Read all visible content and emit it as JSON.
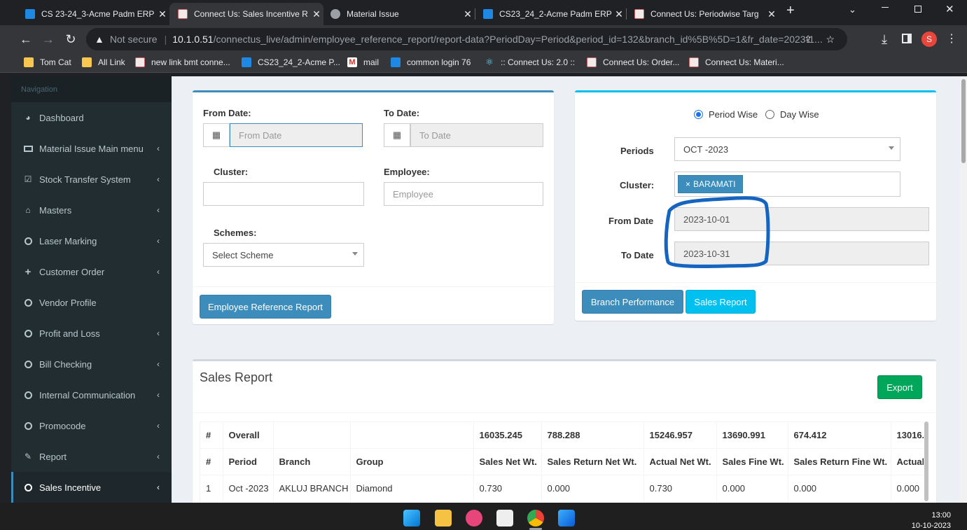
{
  "browser": {
    "tabs": [
      {
        "title": "CS 23-24_3-Acme Padm ERP",
        "close": "✕"
      },
      {
        "title": "Connect Us: Sales Incentive R",
        "close": "✕"
      },
      {
        "title": "Material Issue",
        "close": "✕"
      },
      {
        "title": "CS23_24_2-Acme Padm ERP",
        "close": "✕"
      },
      {
        "title": "Connect Us: Periodwise Targ",
        "close": "✕"
      }
    ],
    "new_tab": "+",
    "security": "Not secure",
    "url_host": "10.1.0.51",
    "url_path": "/connectus_live/admin/employee_reference_report/report-data?PeriodDay=Period&period_id=132&branch_id%5B%5D=1&fr_date=2023-1...",
    "profile_initial": "S",
    "bookmarks": [
      "Tom Cat",
      "All Link",
      "new link bmt conne...",
      "CS23_24_2-Acme P...",
      "mail",
      "common login 76",
      ":: Connect Us: 2.0 ::",
      "Connect Us: Order...",
      "Connect Us: Materi..."
    ]
  },
  "sidebar": {
    "header": "Navigation",
    "items": [
      {
        "label": "Dashboard",
        "icon": "dashboard-icon"
      },
      {
        "label": "Material Issue Main menu",
        "icon": "id-card-icon"
      },
      {
        "label": "Stock Transfer System",
        "icon": "check-square-icon"
      },
      {
        "label": "Masters",
        "icon": "home-icon"
      },
      {
        "label": "Laser Marking",
        "icon": "circle-icon"
      },
      {
        "label": "Customer Order",
        "icon": "plus-icon"
      },
      {
        "label": "Vendor Profile",
        "icon": "circle-icon"
      },
      {
        "label": "Profit and Loss",
        "icon": "circle-icon"
      },
      {
        "label": "Bill Checking",
        "icon": "circle-icon"
      },
      {
        "label": "Internal Communication",
        "icon": "circle-icon"
      },
      {
        "label": "Promocode",
        "icon": "circle-icon"
      },
      {
        "label": "Report",
        "icon": "pencil-icon"
      },
      {
        "label": "Sales Incentive",
        "icon": "circle-icon"
      }
    ]
  },
  "left_form": {
    "from_label": "From Date:",
    "from_placeholder": "From Date",
    "to_label": "To Date:",
    "to_placeholder": "To Date",
    "cluster_label": "Cluster:",
    "employee_label": "Employee:",
    "employee_placeholder": "Employee",
    "schemes_label": "Schemes:",
    "schemes_value": "Select Scheme",
    "button": "Employee Reference Report"
  },
  "right_form": {
    "radio_period": "Period Wise",
    "radio_day": "Day Wise",
    "periods_label": "Periods",
    "periods_value": "OCT -2023",
    "cluster_label": "Cluster:",
    "cluster_tag_x": "×",
    "cluster_tag": "BARAMATI",
    "from_label": "From Date",
    "from_value": "2023-10-01",
    "to_label": "To Date",
    "to_value": "2023-10-31",
    "btn_branch": "Branch Performance",
    "btn_sales": "Sales Report"
  },
  "report": {
    "title": "Sales Report",
    "export": "Export",
    "overall_row": [
      "#",
      "Overall",
      "",
      "",
      "16035.245",
      "788.288",
      "15246.957",
      "13690.991",
      "674.412",
      "13016."
    ],
    "header_row": [
      "#",
      "Period",
      "Branch",
      "Group",
      "Sales Net Wt.",
      "Sales Return Net Wt.",
      "Actual Net Wt.",
      "Sales Fine Wt.",
      "Sales Return Fine Wt.",
      "Actual"
    ],
    "rows": [
      [
        "1",
        "Oct -2023",
        "AKLUJ BRANCH",
        "Diamond",
        "0.730",
        "0.000",
        "0.730",
        "0.000",
        "0.000",
        "0.000"
      ]
    ]
  },
  "taskbar": {
    "time": "13:00",
    "date": "10-10-2023"
  },
  "colors": {
    "annotation": "#1565c0",
    "primary": "#3c8dbc",
    "info": "#00c0ef",
    "success": "#00a65a",
    "sidebar": "#222d32"
  }
}
